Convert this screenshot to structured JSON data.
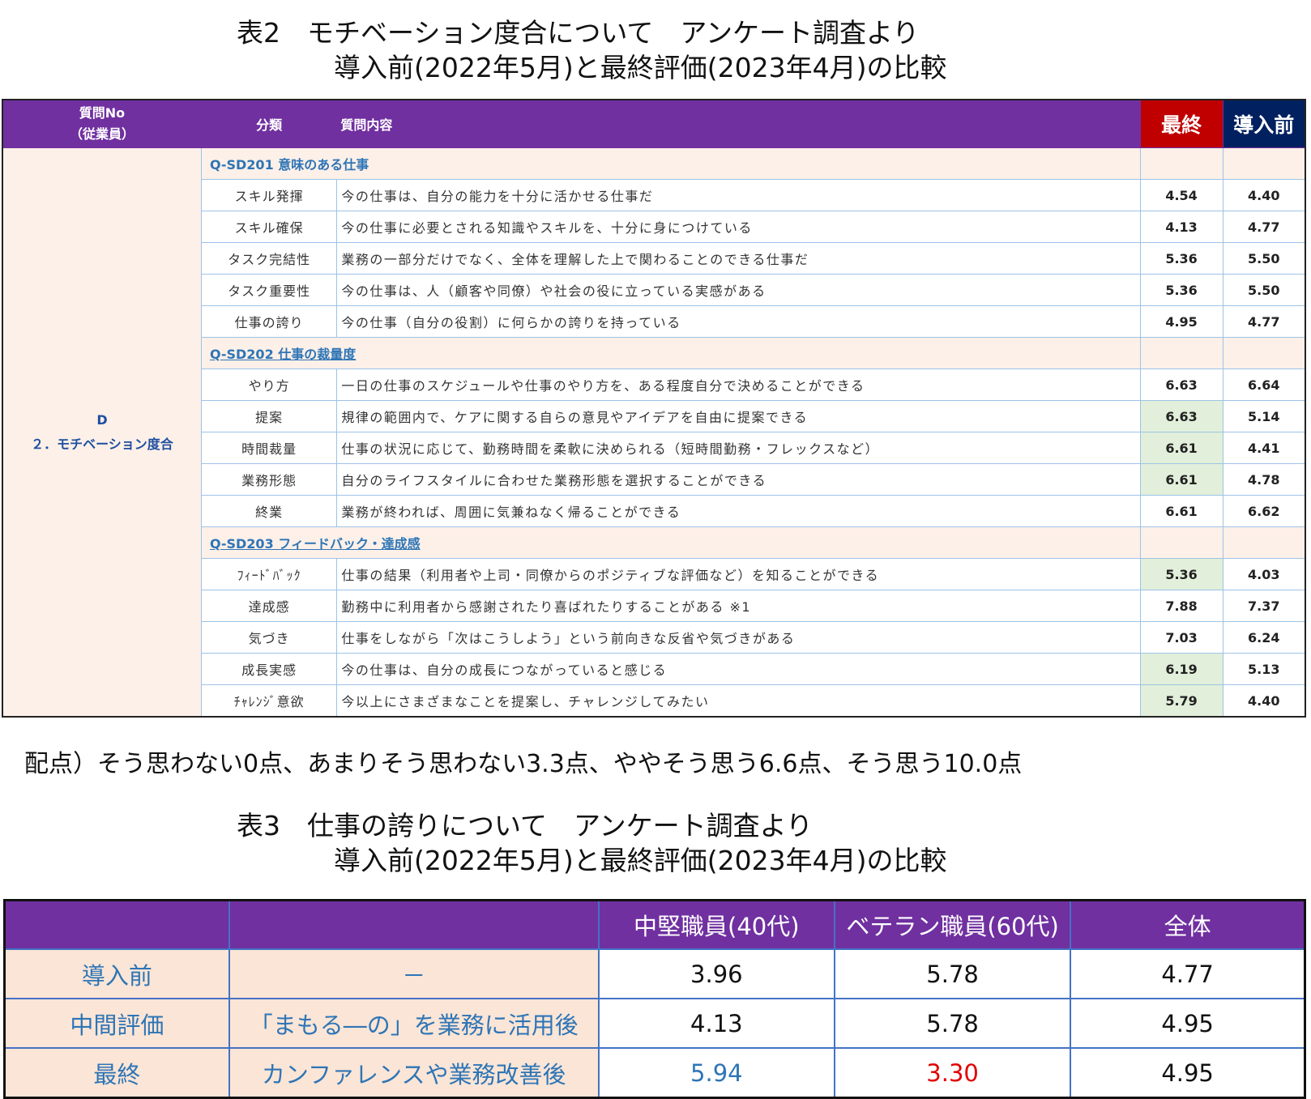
{
  "table2": {
    "title_line1": "表2　モチベーション度合について　アンケート調査より",
    "title_line2": "導入前(2022年5月)と最終評価(2023年4月)の比較",
    "headers": {
      "no_line1": "質問No",
      "no_line2": "（従業員）",
      "classification": "分類",
      "question": "質問内容",
      "final": "最終",
      "before": "導入前"
    },
    "category_line1": "D",
    "category_line2": "２．モチベーション度合",
    "sections": [
      {
        "title": "Q-SD201 意味のある仕事",
        "underline": false,
        "rows": [
          {
            "classification": "スキル発揮",
            "question": "今の仕事は、自分の能力を十分に活かせる仕事だ",
            "final": "4.54",
            "before": "4.40",
            "highlight": false
          },
          {
            "classification": "スキル確保",
            "question": "今の仕事に必要とされる知識やスキルを、十分に身につけている",
            "final": "4.13",
            "before": "4.77",
            "highlight": false
          },
          {
            "classification": "タスク完結性",
            "question": "業務の一部分だけでなく、全体を理解した上で関わることのできる仕事だ",
            "final": "5.36",
            "before": "5.50",
            "highlight": false
          },
          {
            "classification": "タスク重要性",
            "question": "今の仕事は、人（顧客や同僚）や社会の役に立っている実感がある",
            "final": "5.36",
            "before": "5.50",
            "highlight": false
          },
          {
            "classification": "仕事の誇り",
            "question": "今の仕事（自分の役割）に何らかの誇りを持っている",
            "final": "4.95",
            "before": "4.77",
            "highlight": false
          }
        ]
      },
      {
        "title": "Q-SD202 仕事の裁量度",
        "underline": true,
        "rows": [
          {
            "classification": "やり方",
            "question": "一日の仕事のスケジュールや仕事のやり方を、ある程度自分で決めることができる",
            "final": "6.63",
            "before": "6.64",
            "highlight": false
          },
          {
            "classification": "提案",
            "question": "規律の範囲内で、ケアに関する自らの意見やアイデアを自由に提案できる",
            "final": "6.63",
            "before": "5.14",
            "highlight": true
          },
          {
            "classification": "時間裁量",
            "question": "仕事の状況に応じて、勤務時間を柔軟に決められる（短時間勤務・フレックスなど）",
            "final": "6.61",
            "before": "4.41",
            "highlight": true
          },
          {
            "classification": "業務形態",
            "question": "自分のライフスタイルに合わせた業務形態を選択することができる",
            "final": "6.61",
            "before": "4.78",
            "highlight": true
          },
          {
            "classification": "終業",
            "question": "業務が終われば、周囲に気兼ねなく帰ることができる",
            "final": "6.61",
            "before": "6.62",
            "highlight": false
          }
        ]
      },
      {
        "title": "Q-SD203 フィードバック・達成感",
        "underline": true,
        "rows": [
          {
            "classification": "ﾌｨｰﾄﾞﾊﾞｯｸ",
            "question": "仕事の結果（利用者や上司・同僚からのポジティブな評価など）を知ることができる",
            "final": "5.36",
            "before": "4.03",
            "highlight": true
          },
          {
            "classification": "達成感",
            "question": "勤務中に利用者から感謝されたり喜ばれたりすることがある ※1",
            "final": "7.88",
            "before": "7.37",
            "highlight": false
          },
          {
            "classification": "気づき",
            "question": "仕事をしながら「次はこうしよう」という前向きな反省や気づきがある",
            "final": "7.03",
            "before": "6.24",
            "highlight": false
          },
          {
            "classification": "成長実感",
            "question": "今の仕事は、自分の成長につながっていると感じる",
            "final": "6.19",
            "before": "5.13",
            "highlight": true
          },
          {
            "classification": "ﾁｬﾚﾝｼﾞ意欲",
            "question": "今以上にさまざまなことを提案し、チャレンジしてみたい",
            "final": "5.79",
            "before": "4.40",
            "highlight": true
          }
        ]
      }
    ]
  },
  "score_note": "配点）そう思わない0点、あまりそう思わない3.3点、ややそう思う6.6点、そう思う10.0点",
  "table3": {
    "title_line1": "表3　仕事の誇りについて　アンケート調査より",
    "title_line2": "導入前(2022年5月)と最終評価(2023年4月)の比較",
    "headers": [
      "",
      "",
      "中堅職員(40代)",
      "ベテラン職員(60代)",
      "全体"
    ],
    "rows": [
      {
        "label": "導入前",
        "situation": "－",
        "mid": "3.96",
        "veteran": "5.78",
        "overall": "4.77"
      },
      {
        "label": "中間評価",
        "situation": "「まもる―の」を業務に活用後",
        "mid": "4.13",
        "veteran": "5.78",
        "overall": "4.95"
      },
      {
        "label": "最終",
        "situation": "カンファレンスや業務改善後",
        "mid": "5.94",
        "veteran": "3.30",
        "overall": "4.95"
      }
    ]
  },
  "colors": {
    "header_purple": "#7030a0",
    "final_red": "#c00000",
    "before_navy": "#002060",
    "highlight_green": "#e2efda",
    "label_peach": "#fbe5d6",
    "value_blue": "#2e75b6",
    "value_red": "#e00000"
  }
}
